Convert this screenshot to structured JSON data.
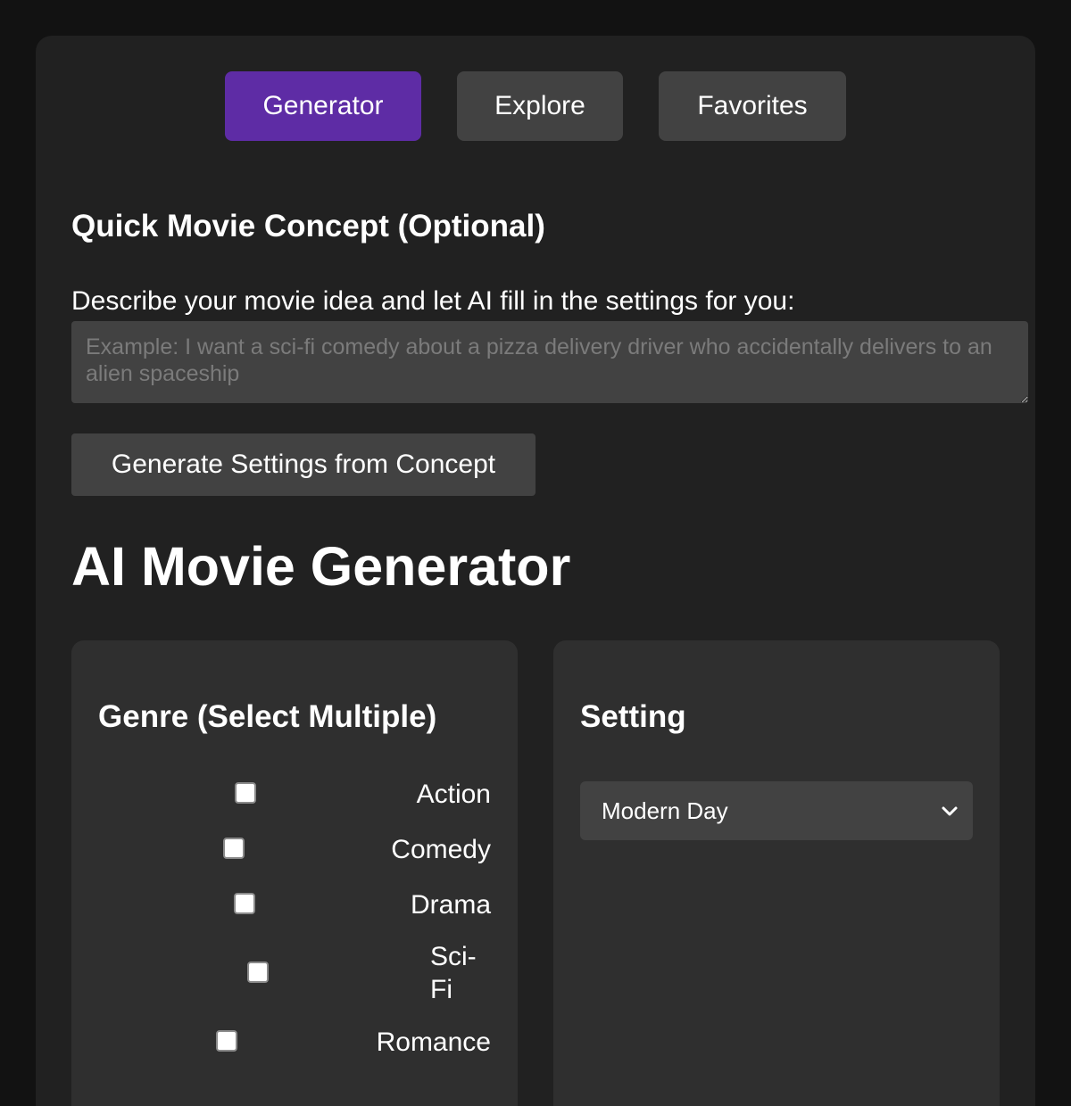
{
  "tabs": [
    {
      "label": "Generator",
      "active": true
    },
    {
      "label": "Explore",
      "active": false
    },
    {
      "label": "Favorites",
      "active": false
    }
  ],
  "concept": {
    "title": "Quick Movie Concept (Optional)",
    "description": "Describe your movie idea and let AI fill in the settings for you:",
    "placeholder": "Example: I want a sci-fi comedy about a pizza delivery driver who accidentally delivers to an alien spaceship",
    "value": "",
    "button_label": "Generate Settings from Concept"
  },
  "main_title": "AI Movie Generator",
  "genre_panel": {
    "title": "Genre (Select Multiple)",
    "options": [
      {
        "label": "Action",
        "checked": false
      },
      {
        "label": "Comedy",
        "checked": false
      },
      {
        "label": "Drama",
        "checked": false
      },
      {
        "label": "Sci-Fi",
        "checked": false
      },
      {
        "label": "Romance",
        "checked": false
      }
    ]
  },
  "setting_panel": {
    "title": "Setting",
    "selected": "Modern Day"
  },
  "colors": {
    "page_background": "#121212",
    "card_background": "#212121",
    "panel_background": "#2f2f2f",
    "control_background": "#424242",
    "accent": "#5e2ca5",
    "text": "#ffffff",
    "placeholder_text": "#7b7b7b"
  },
  "icons": {
    "dropdown": "chevron-down-icon",
    "checkbox": "checkbox-icon"
  }
}
